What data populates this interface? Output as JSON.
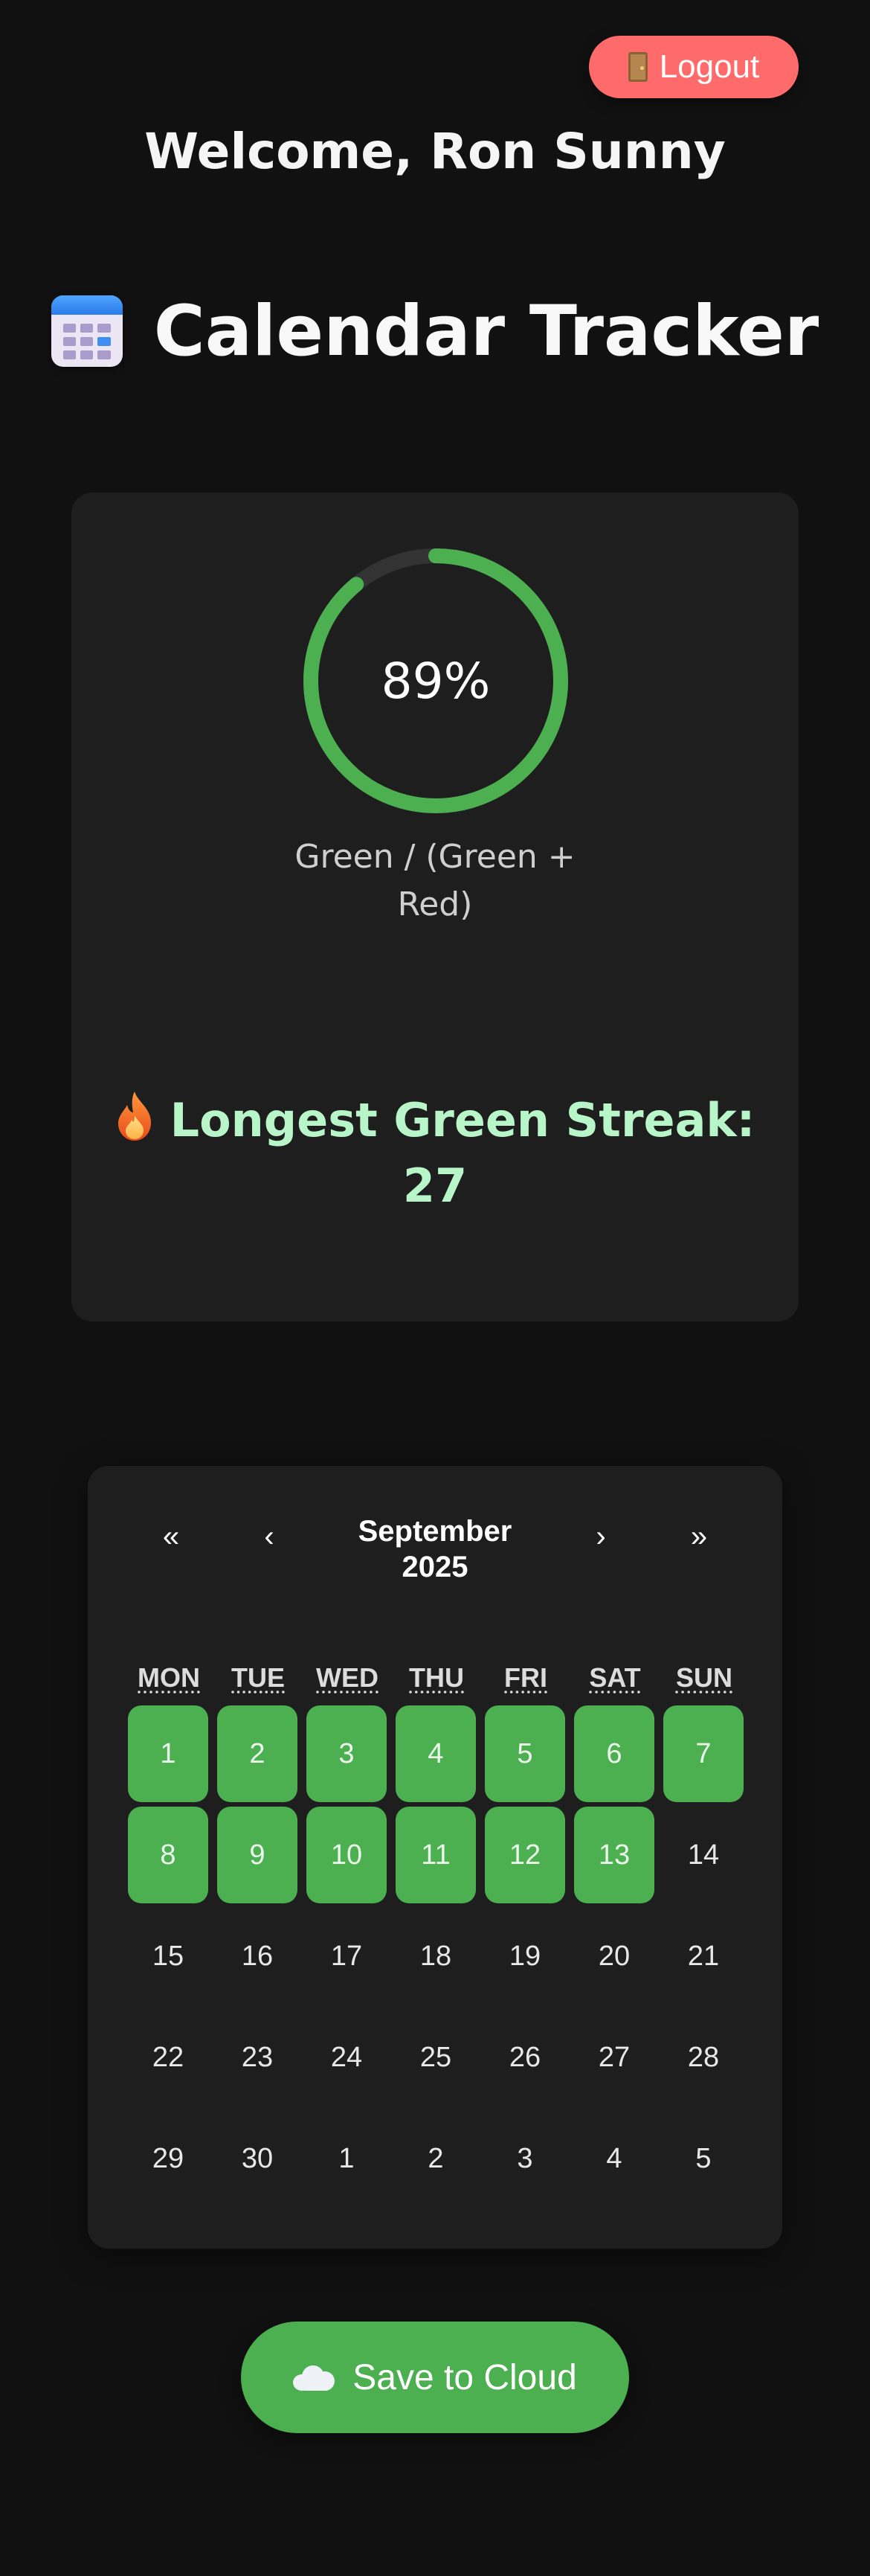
{
  "header": {
    "logout_label": "Logout",
    "welcome_text": "Welcome, Ron Sunny"
  },
  "app": {
    "title": "Calendar Tracker"
  },
  "stats": {
    "ratio_percent": 89,
    "ratio_label": "89%",
    "ratio_caption": "Green / (Green + Red)",
    "streak_label": "Longest Green Streak: 27",
    "colors": {
      "ring_fill": "#4caf50",
      "ring_track": "#333333",
      "streak_text": "#b8f5c8"
    }
  },
  "calendar": {
    "nav": {
      "prev_year": "«",
      "prev_month": "‹",
      "next_month": "›",
      "next_year": "»"
    },
    "month_title_line1": "September",
    "month_title_line2": "2025",
    "weekdays": [
      "MON",
      "TUE",
      "WED",
      "THU",
      "FRI",
      "SAT",
      "SUN"
    ],
    "weeks": [
      [
        {
          "d": "1",
          "s": "green"
        },
        {
          "d": "2",
          "s": "green"
        },
        {
          "d": "3",
          "s": "green"
        },
        {
          "d": "4",
          "s": "green"
        },
        {
          "d": "5",
          "s": "green"
        },
        {
          "d": "6",
          "s": "green"
        },
        {
          "d": "7",
          "s": "green"
        }
      ],
      [
        {
          "d": "8",
          "s": "green"
        },
        {
          "d": "9",
          "s": "green"
        },
        {
          "d": "10",
          "s": "green"
        },
        {
          "d": "11",
          "s": "green"
        },
        {
          "d": "12",
          "s": "green"
        },
        {
          "d": "13",
          "s": "green"
        },
        {
          "d": "14",
          "s": "none"
        }
      ],
      [
        {
          "d": "15",
          "s": "none"
        },
        {
          "d": "16",
          "s": "none"
        },
        {
          "d": "17",
          "s": "none"
        },
        {
          "d": "18",
          "s": "none"
        },
        {
          "d": "19",
          "s": "none"
        },
        {
          "d": "20",
          "s": "none"
        },
        {
          "d": "21",
          "s": "none"
        }
      ],
      [
        {
          "d": "22",
          "s": "none"
        },
        {
          "d": "23",
          "s": "none"
        },
        {
          "d": "24",
          "s": "none"
        },
        {
          "d": "25",
          "s": "none"
        },
        {
          "d": "26",
          "s": "none"
        },
        {
          "d": "27",
          "s": "none"
        },
        {
          "d": "28",
          "s": "none"
        }
      ],
      [
        {
          "d": "29",
          "s": "none"
        },
        {
          "d": "30",
          "s": "none"
        },
        {
          "d": "1",
          "s": "none"
        },
        {
          "d": "2",
          "s": "none"
        },
        {
          "d": "3",
          "s": "none"
        },
        {
          "d": "4",
          "s": "none"
        },
        {
          "d": "5",
          "s": "none"
        }
      ]
    ],
    "colors": {
      "green_day": "#4caf50"
    }
  },
  "actions": {
    "save_label": "Save to Cloud"
  }
}
